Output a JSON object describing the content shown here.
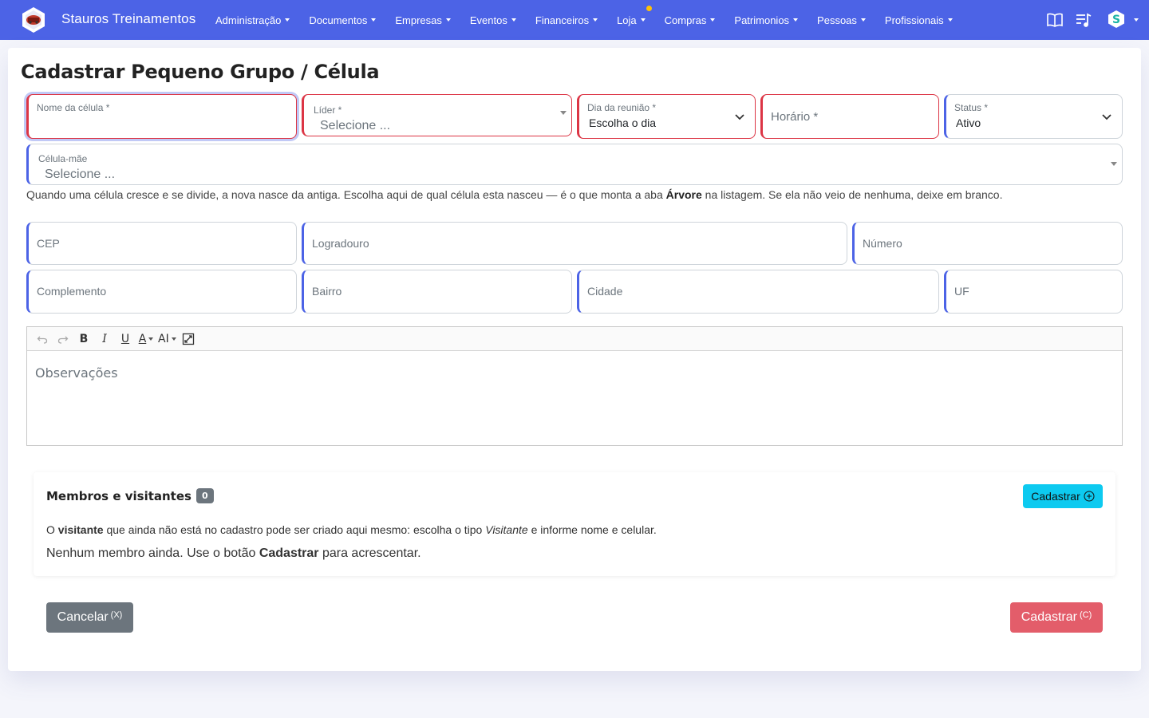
{
  "nav": {
    "brand": "Stauros Treinamentos",
    "menu": [
      "Administração",
      "Documentos",
      "Empresas",
      "Eventos",
      "Financeiros",
      "Loja",
      "Compras",
      "Patrimonios",
      "Pessoas",
      "Profissionais"
    ],
    "icons": [
      "book-icon",
      "playlist-icon",
      "user-avatar-icon"
    ],
    "accent": "#4c63e6",
    "notification_color": "#ffc107"
  },
  "page": {
    "title": "Cadastrar Pequeno Grupo / Célula"
  },
  "form": {
    "nome": {
      "label": "Nome da célula *",
      "value": ""
    },
    "lider": {
      "label": "Líder *",
      "placeholder": "Selecione ..."
    },
    "dia": {
      "label": "Dia da reunião *",
      "value": "Escolha o dia"
    },
    "horario": {
      "placeholder": "Horário *"
    },
    "status": {
      "label": "Status *",
      "value": "Ativo"
    },
    "celula_mae": {
      "label": "Célula-mãe",
      "placeholder": "Selecione ..."
    },
    "help": {
      "part1": "Quando uma célula cresce e se divide, a nova nasce da antiga. Escolha aqui de qual célula esta nasceu — é o que monta a aba ",
      "bold": "Árvore",
      "part2": " na listagem. Se ela não veio de nenhuma, deixe em branco."
    },
    "cep": {
      "placeholder": "CEP"
    },
    "logradouro": {
      "placeholder": "Logradouro"
    },
    "numero": {
      "placeholder": "Número"
    },
    "complemento": {
      "placeholder": "Complemento"
    },
    "bairro": {
      "placeholder": "Bairro"
    },
    "cidade": {
      "placeholder": "Cidade"
    },
    "uf": {
      "placeholder": "UF"
    }
  },
  "editor": {
    "toolbar": [
      "undo",
      "redo",
      "B",
      "I",
      "U",
      "A",
      "AI",
      "fullscreen"
    ],
    "placeholder": "Observações"
  },
  "members": {
    "title": "Membros e visitantes",
    "count": "0",
    "add_label": "Cadastrar",
    "hint_pre": "O ",
    "hint_bold": "visitante",
    "hint_mid": " que ainda não está no cadastro pode ser criado aqui mesmo: escolha o tipo ",
    "hint_italic": "Visitante",
    "hint_post": " e informe nome e celular.",
    "empty_pre": "Nenhum membro ainda. Use o botão ",
    "empty_bold": "Cadastrar",
    "empty_post": " para acrescentar."
  },
  "actions": {
    "cancel": "Cancelar",
    "cancel_key": "(X)",
    "submit": "Cadastrar",
    "submit_key": "(C)",
    "cancel_color": "#6c757d",
    "submit_color": "#e35d6a"
  }
}
